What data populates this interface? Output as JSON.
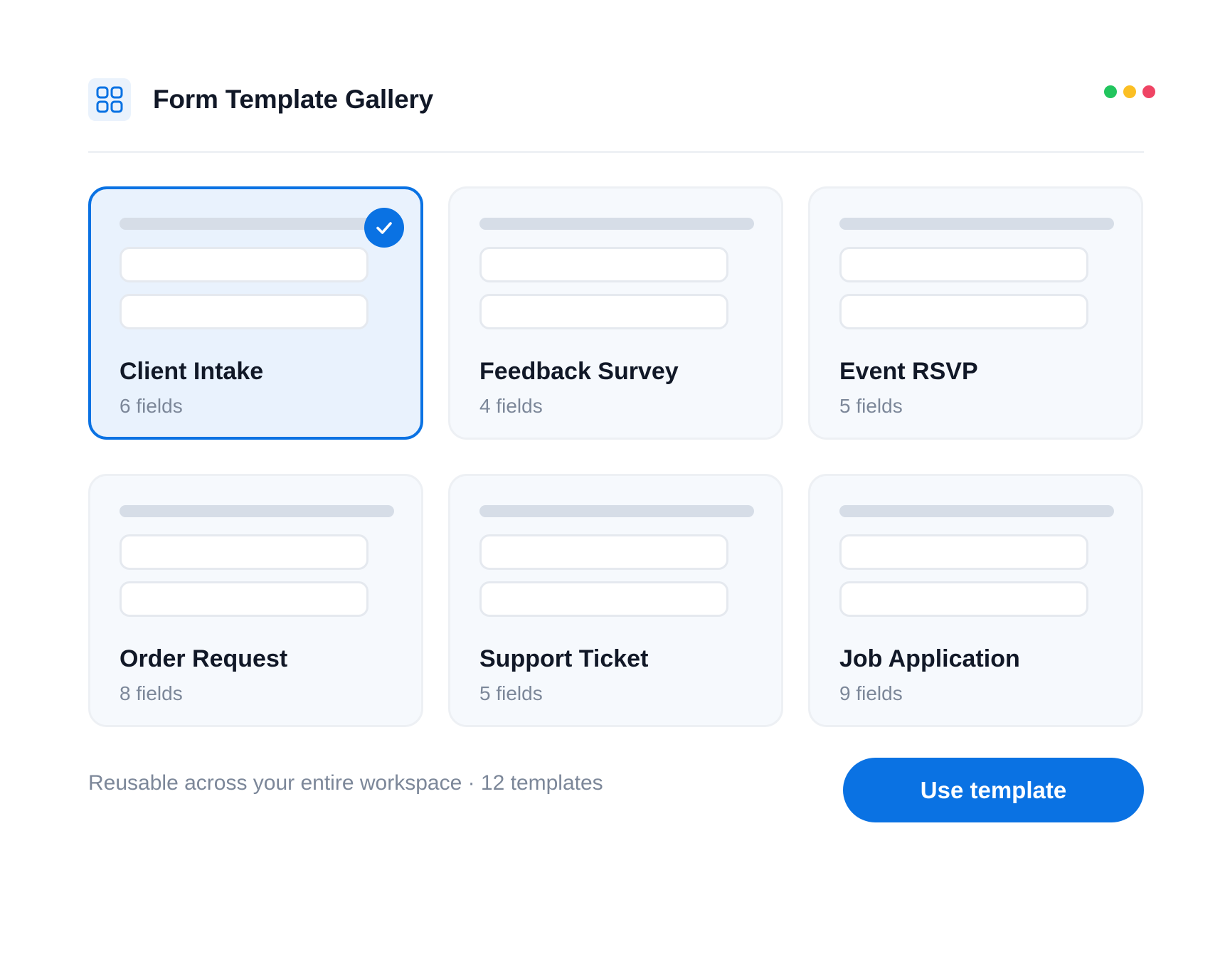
{
  "header": {
    "title": "Form Template Gallery",
    "icon": "grid-icon"
  },
  "window_controls": {
    "colors": [
      "#22c55e",
      "#fbbf24",
      "#ef4464"
    ]
  },
  "templates": [
    {
      "title": "Client Intake",
      "fields": "6 fields",
      "selected": true
    },
    {
      "title": "Feedback Survey",
      "fields": "4 fields",
      "selected": false
    },
    {
      "title": "Event RSVP",
      "fields": "5 fields",
      "selected": false
    },
    {
      "title": "Order Request",
      "fields": "8 fields",
      "selected": false
    },
    {
      "title": "Support Ticket",
      "fields": "5 fields",
      "selected": false
    },
    {
      "title": "Job Application",
      "fields": "9 fields",
      "selected": false
    }
  ],
  "footer": {
    "note": "Reusable across your entire workspace · 12 templates",
    "button_label": "Use template"
  },
  "colors": {
    "accent": "#0a72e3",
    "muted_text": "#7c8799"
  }
}
